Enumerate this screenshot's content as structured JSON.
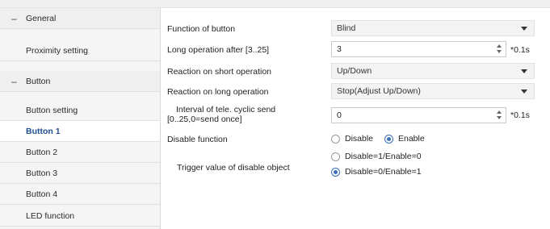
{
  "sidebar": {
    "items": [
      {
        "label": "General",
        "type": "group"
      },
      {
        "label": "Proximity setting",
        "type": "child"
      },
      {
        "label": "Button",
        "type": "group"
      },
      {
        "label": "Button setting",
        "type": "child"
      },
      {
        "label": "Button 1",
        "type": "child",
        "active": true
      },
      {
        "label": "Button 2",
        "type": "child"
      },
      {
        "label": "Button 3",
        "type": "child"
      },
      {
        "label": "Button 4",
        "type": "child"
      },
      {
        "label": "LED function",
        "type": "child"
      }
    ],
    "collapse_symbol": "–"
  },
  "form": {
    "function_label": "Function of button",
    "function_value": "Blind",
    "long_op_label": "Long operation after [3..25]",
    "long_op_value": "3",
    "long_op_unit": "*0.1s",
    "short_reaction_label": "Reaction on short operation",
    "short_reaction_value": "Up/Down",
    "long_reaction_label": "Reaction on long operation",
    "long_reaction_value": "Stop(Adjust Up/Down)",
    "interval_label_line1": "Interval of tele. cyclic send",
    "interval_label_line2": "[0..25,0=send once]",
    "interval_value": "0",
    "interval_unit": "*0.1s",
    "disable_label": "Disable function",
    "disable_options": [
      "Disable",
      "Enable"
    ],
    "disable_selected": "Enable",
    "trigger_label": "Trigger value of disable object",
    "trigger_options": [
      "Disable=1/Enable=0",
      "Disable=0/Enable=1"
    ],
    "trigger_selected": "Disable=0/Enable=1"
  },
  "colors": {
    "accent": "#3b6fb6",
    "active_text": "#1f4f8f"
  }
}
